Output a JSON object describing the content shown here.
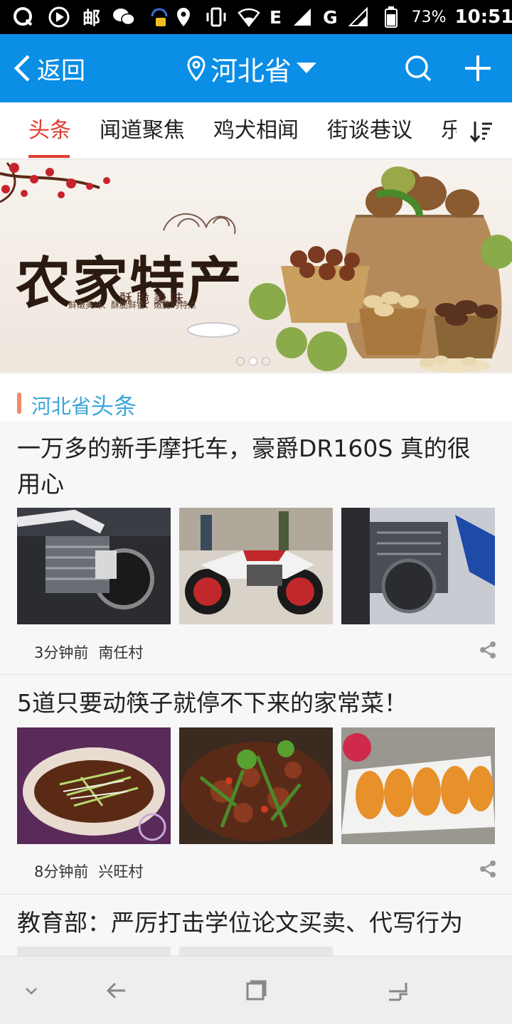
{
  "status_bar": {
    "battery": "73%",
    "time": "10:51",
    "network_e": "E",
    "network_g": "G",
    "app_mail": "邮"
  },
  "app_bar": {
    "back_label": "返回",
    "province": "河北省"
  },
  "tabs": [
    {
      "label": "头条",
      "active": true
    },
    {
      "label": "闻道聚焦"
    },
    {
      "label": "鸡犬相闻"
    },
    {
      "label": "街谈巷议"
    },
    {
      "label": "乐"
    }
  ],
  "banner": {
    "title": "农家特产",
    "subtitle": "酥脆美味",
    "caption": "鲜嫩美味、酥脆鲜香、嫩脆的特点",
    "page_count": 3,
    "current_page": 2
  },
  "section": {
    "province": "河北省",
    "heading": "头条"
  },
  "articles": [
    {
      "title": "一万多的新手摩托车，豪爵DR160S 真的很用心",
      "time": "3分钟前",
      "village": "南任村",
      "images": [
        "motorcycle-engine-photo",
        "white-red-motorcycle-photo",
        "motorcycle-side-photo"
      ]
    },
    {
      "title": "5道只要动筷子就停不下来的家常菜！",
      "time": "8分钟前",
      "village": "兴旺村",
      "images": [
        "steamed-fish-photo",
        "stir-fry-dish-photo",
        "fried-shrimp-photo"
      ]
    },
    {
      "title": "教育部：严厉打击学位论文买卖、代写行为"
    }
  ],
  "icons": {
    "back": "chevron-left-icon",
    "location": "location-pin-icon",
    "dropdown": "caret-down-icon",
    "search": "search-icon",
    "add": "plus-icon",
    "sort": "sort-icon",
    "share": "share-icon"
  },
  "colors": {
    "app_bar": "#0a8ee6",
    "tab_active": "#e23c2e",
    "section_accent": "#3aa5d8",
    "section_bar": "#f08a6a"
  }
}
